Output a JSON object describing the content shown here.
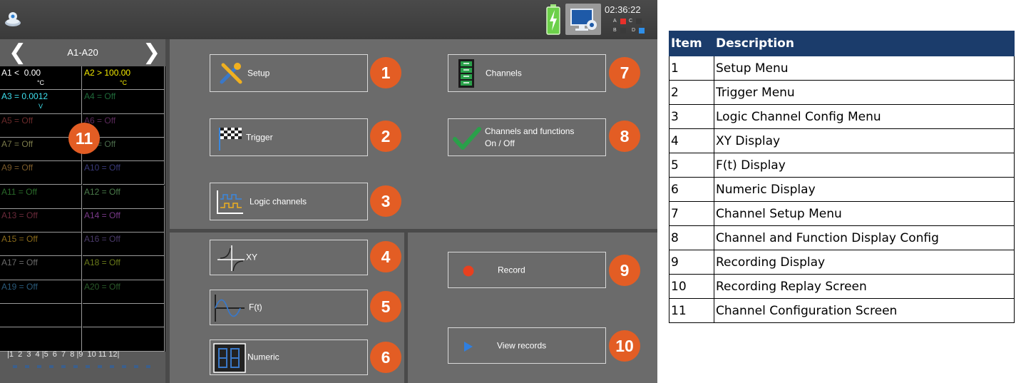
{
  "status_bar": {
    "clock": "02:36:22",
    "indicators": [
      "A",
      "C",
      "B",
      "D"
    ],
    "icons": [
      "logo-icon",
      "battery-charging-icon",
      "monitor-icon"
    ]
  },
  "channel_panel": {
    "range": "A1-A20",
    "cells": [
      {
        "value": "A1 <  0.00",
        "unit": "°C",
        "color": "#ffffff"
      },
      {
        "value": "A2 > 100.00",
        "unit": "°C",
        "color": "#f2e900"
      },
      {
        "value": "A3 = 0.0012",
        "unit": "V",
        "color": "#3ee0ee"
      },
      {
        "value": "A4 = Off",
        "unit": "",
        "color": "#1f6a3a"
      },
      {
        "value": "A5 = Off",
        "unit": "",
        "color": "#6a2a2a"
      },
      {
        "value": "A6 = Off",
        "unit": "",
        "color": "#5a2a5a"
      },
      {
        "value": "A7 = Off",
        "unit": "",
        "color": "#7a7a4a"
      },
      {
        "value": "A8 = Off",
        "unit": "",
        "color": "#4a6a4a"
      },
      {
        "value": "A9 = Off",
        "unit": "",
        "color": "#7a5a2a"
      },
      {
        "value": "A10 = Off",
        "unit": "",
        "color": "#3a3a7a"
      },
      {
        "value": "A11 = Off",
        "unit": "",
        "color": "#2a6a2a"
      },
      {
        "value": "A12 = Off",
        "unit": "",
        "color": "#4a7a4a"
      },
      {
        "value": "A13 = Off",
        "unit": "",
        "color": "#6a2a3a"
      },
      {
        "value": "A14 = Off",
        "unit": "",
        "color": "#7a3a8a"
      },
      {
        "value": "A15 = Off",
        "unit": "",
        "color": "#8a6a1a"
      },
      {
        "value": "A16 = Off",
        "unit": "",
        "color": "#4a3a6a"
      },
      {
        "value": "A17 = Off",
        "unit": "",
        "color": "#6a6a6a"
      },
      {
        "value": "A18 = Off",
        "unit": "",
        "color": "#6a7a1a"
      },
      {
        "value": "A19 = Off",
        "unit": "",
        "color": "#2a5a7a"
      },
      {
        "value": "A20 = Off",
        "unit": "",
        "color": "#2a5a2a"
      },
      {
        "value": "",
        "unit": "",
        "color": "#ffffff"
      },
      {
        "value": "",
        "unit": "",
        "color": "#ffffff"
      },
      {
        "value": "",
        "unit": "",
        "color": "#ffffff"
      },
      {
        "value": "",
        "unit": "",
        "color": "#ffffff"
      }
    ],
    "page_indicator": "|1  2  3  4 |5  6  7  8 |9  10 11 12|"
  },
  "menu": {
    "setup": "Setup",
    "trigger": "Trigger",
    "logic": "Logic channels",
    "xy": "XY",
    "ft": "F(t)",
    "numeric": "Numeric",
    "channels": "Channels",
    "channels_functions": "Channels and functions\nOn / Off",
    "record": "Record",
    "view_records": "View records"
  },
  "badges": [
    "1",
    "2",
    "3",
    "4",
    "5",
    "6",
    "7",
    "8",
    "9",
    "10",
    "11"
  ],
  "colors": {
    "badge": "#e35d24",
    "table_header": "#1b3c6b",
    "record_dot": "#e8401f",
    "play_arrow": "#2f7fe0",
    "check": "#2aa04a"
  },
  "table": {
    "headers": [
      "Item",
      "Description"
    ],
    "rows": [
      [
        "1",
        "Setup Menu"
      ],
      [
        "2",
        "Trigger Menu"
      ],
      [
        "3",
        "Logic Channel Config Menu"
      ],
      [
        "4",
        "XY Display"
      ],
      [
        "5",
        "F(t) Display"
      ],
      [
        "6",
        "Numeric Display"
      ],
      [
        "7",
        "Channel Setup Menu"
      ],
      [
        "8",
        "Channel and Function Display Config"
      ],
      [
        "9",
        "Recording Display"
      ],
      [
        "10",
        "Recording Replay Screen"
      ],
      [
        "11",
        "Channel Configuration Screen"
      ]
    ]
  }
}
